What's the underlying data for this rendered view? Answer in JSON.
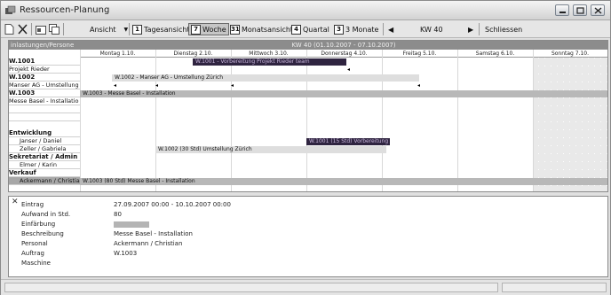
{
  "window": {
    "title": "Ressourcen-Planung"
  },
  "toolbar": {
    "ansicht": "Ansicht",
    "views": [
      {
        "icon": "1",
        "label": "Tagesansicht"
      },
      {
        "icon": "7",
        "label": "Woche"
      },
      {
        "icon": "31",
        "label": "Monatsansicht"
      },
      {
        "icon": "4",
        "label": "Quartal"
      },
      {
        "icon": "3",
        "label": "3 Monate"
      }
    ],
    "week_label": "KW 40",
    "close_label": "Schliessen"
  },
  "grid": {
    "header_label": "inlastungen/Persone",
    "week_header": "KW 40 (01.10.2007 - 07.10.2007)",
    "days": [
      "Montag 1.10.",
      "Dienstag 2.10.",
      "Mittwoch 3.10.",
      "Donnerstag 4.10.",
      "Freitag 5.10.",
      "Samstag 6.10.",
      "Sonntag 7.10."
    ],
    "rows": [
      "W.1001",
      "Projekt Rieder",
      "W.1002",
      "Manser AG - Umstellung",
      "W.1003",
      "Messe Basel - Installatio",
      "",
      "",
      "Entwicklung",
      "Janser / Daniel",
      "Zeller / Gabriela",
      "Sekretariat / Admin",
      "Elmer / Karin",
      "Verkauf",
      "Ackermann / Christian"
    ],
    "bars": {
      "b1": "W.1001 - Vorbereitung Projekt Rieder team",
      "b2": "W.1002 - Manser AG - Umstellung Zürich",
      "b3": "W.1003 - Messe Basel - Installation",
      "b4": "W.1001 (15 Std) Vorbereitung",
      "b5": "W.1002 (30 Std) Umstellung Zürich",
      "b6": "W.1003 (80 Std) Messe Basel - Installation"
    }
  },
  "detail": {
    "fields": [
      {
        "label": "Eintrag",
        "value": "27.09.2007 00:00 - 10.10.2007 00:00"
      },
      {
        "label": "Aufwand in Std.",
        "value": "80"
      },
      {
        "label": "Einfärbung",
        "value": ""
      },
      {
        "label": "Beschreibung",
        "value": "Messe Basel - Installation"
      },
      {
        "label": "Personal",
        "value": "Ackermann / Christian"
      },
      {
        "label": "Auftrag",
        "value": "W.1003"
      },
      {
        "label": "Maschine",
        "value": ""
      }
    ],
    "colors": {
      "einfaerbung": "#b4b4b4"
    }
  },
  "colors": {
    "bar_dark": "#2f2440",
    "header_gray": "#8c8c8c"
  }
}
